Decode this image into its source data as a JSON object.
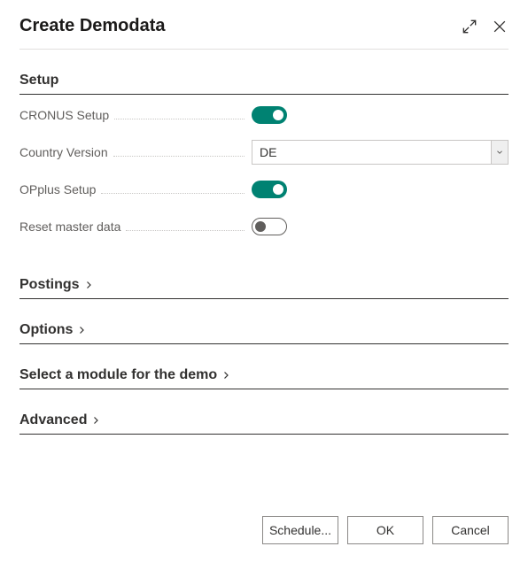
{
  "dialog": {
    "title": "Create Demodata"
  },
  "sections": {
    "setup": "Setup",
    "postings": "Postings",
    "options": "Options",
    "select_module": "Select a module for the demo",
    "advanced": "Advanced"
  },
  "fields": {
    "cronus_setup": {
      "label": "CRONUS Setup",
      "value": true
    },
    "country_version": {
      "label": "Country Version",
      "value": "DE"
    },
    "opplus_setup": {
      "label": "OPplus Setup",
      "value": true
    },
    "reset_master_data": {
      "label": "Reset master data",
      "value": false
    }
  },
  "buttons": {
    "schedule": "Schedule...",
    "ok": "OK",
    "cancel": "Cancel"
  }
}
